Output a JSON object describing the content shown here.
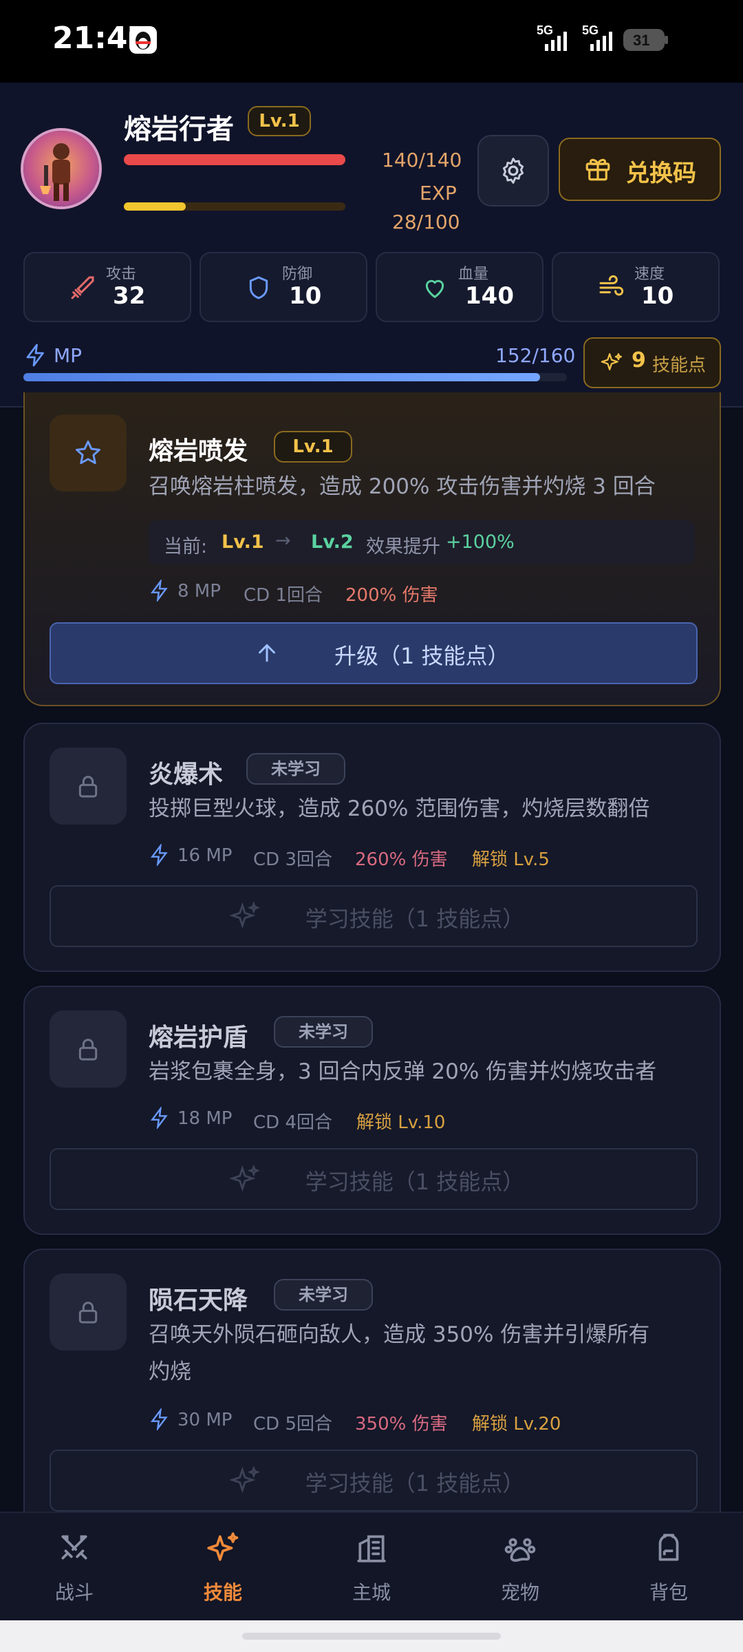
{
  "status": {
    "time": "21:47",
    "battery": "31",
    "net1": "5G",
    "net2": "5G"
  },
  "hero": {
    "name": "熔岩行者",
    "level": "Lv.1",
    "hp": "140/140",
    "hp_fraction": 1.0,
    "exp_label": "EXP",
    "exp": "28/100",
    "exp_fraction": 0.28,
    "redeem_label": "兑换码"
  },
  "stats": [
    {
      "label": "攻击",
      "value": "32",
      "icon": "sword-icon",
      "color": "#e56a6a"
    },
    {
      "label": "防御",
      "value": "10",
      "icon": "shield-icon",
      "color": "#6a9aff"
    },
    {
      "label": "血量",
      "value": "140",
      "icon": "heart-icon",
      "color": "#5ad2a0"
    },
    {
      "label": "速度",
      "value": "10",
      "icon": "wind-icon",
      "color": "#f3c24a"
    }
  ],
  "mp": {
    "label": "MP",
    "value": "152/160",
    "fraction": 0.95
  },
  "skill_points": {
    "count": "9",
    "label": "技能点"
  },
  "skills": [
    {
      "name": "熔岩喷发",
      "badge": "Lv.1",
      "desc": "召唤熔岩柱喷发，造成 200% 攻击伤害并灼烧 3 回合",
      "upgrade": {
        "current_label": "当前:",
        "from": "Lv.1",
        "arrow": "→",
        "to": "Lv.2",
        "effect_label": "效果提升",
        "effect": "+100%"
      },
      "mp": "8 MP",
      "cd": "CD 1回合",
      "dmg": "200% 伤害",
      "button": "升级（1 技能点）"
    },
    {
      "name": "炎爆术",
      "badge": "未学习",
      "desc": "投掷巨型火球，造成 260% 范围伤害，灼烧层数翻倍",
      "mp": "16 MP",
      "cd": "CD 3回合",
      "dmg": "260% 伤害",
      "unlock": "解锁 Lv.5",
      "button": "学习技能（1 技能点）"
    },
    {
      "name": "熔岩护盾",
      "badge": "未学习",
      "desc": "岩浆包裹全身，3 回合内反弹 20% 伤害并灼烧攻击者",
      "mp": "18 MP",
      "cd": "CD 4回合",
      "unlock": "解锁 Lv.10",
      "button": "学习技能（1 技能点）"
    },
    {
      "name": "陨石天降",
      "badge": "未学习",
      "desc1": "召唤天外陨石砸向敌人，造成 350% 伤害并引爆所有",
      "desc2": "灼烧",
      "mp": "30 MP",
      "cd": "CD 5回合",
      "dmg": "350% 伤害",
      "unlock": "解锁 Lv.20",
      "button": "学习技能（1 技能点）"
    }
  ],
  "nav": [
    {
      "label": "战斗",
      "icon": "swords-icon",
      "active": false
    },
    {
      "label": "技能",
      "icon": "sparkles-icon",
      "active": true
    },
    {
      "label": "主城",
      "icon": "building-icon",
      "active": false
    },
    {
      "label": "宠物",
      "icon": "paw-icon",
      "active": false
    },
    {
      "label": "背包",
      "icon": "backpack-icon",
      "active": false
    }
  ],
  "colors": {
    "accent": "#f3c24a",
    "active_nav": "#f08a3a",
    "upgrade_btn": "#2a3a6a"
  }
}
